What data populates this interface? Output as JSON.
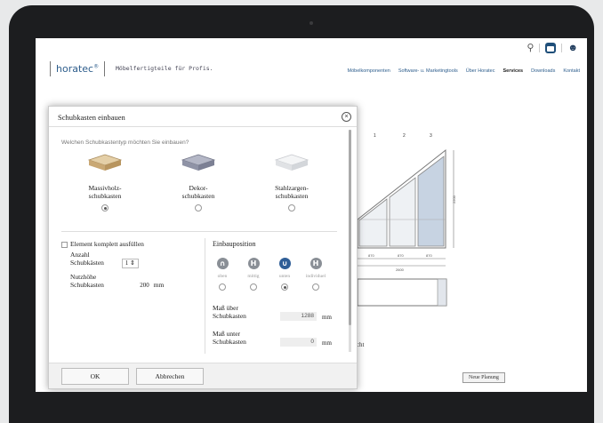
{
  "site": {
    "logo": "horatec",
    "logo_mark": "®",
    "tagline": "Möbelfertigteile für Profis.",
    "nav": [
      "Möbelkomponenten",
      "Software- u. Marketingtools",
      "Über Horatec",
      "Services",
      "Downloads",
      "Kontakt"
    ],
    "nav_active": "Services",
    "cart_count": "0"
  },
  "drawing": {
    "col_numbers": [
      "1",
      "2",
      "3"
    ],
    "dim_labels": [
      "870",
      "870",
      "870"
    ],
    "total_label": "2600",
    "height_label": "2200",
    "view_label": "icht",
    "new_plan_button": "Neue Planung"
  },
  "dialog": {
    "title": "Schubkasten einbauen",
    "question": "Welchen Schubkastentyp möchten Sie einbauen?",
    "types": [
      {
        "line1": "Massivholz-",
        "line2": "schubkasten",
        "selected": true,
        "color": "#d2b88a"
      },
      {
        "line1": "Dekor-",
        "line2": "schubkasten",
        "selected": false,
        "color": "#8f93a6"
      },
      {
        "line1": "Stahlzargen-",
        "line2": "schubkasten",
        "selected": false,
        "color": "#e6e7e9"
      }
    ],
    "fill_label": "Element komplett ausfüllen",
    "count_label1": "Anzahl",
    "count_label2": "Schubkästen",
    "count_value": "1",
    "height_label1": "Nutzhöhe",
    "height_label2": "Schubkasten",
    "height_value": "200",
    "height_unit": "mm",
    "position_title": "Einbauposition",
    "positions": [
      {
        "label": "oben",
        "selected": false
      },
      {
        "label": "mittig",
        "selected": false
      },
      {
        "label": "unten",
        "selected": true
      },
      {
        "label": "individuel",
        "selected": false
      }
    ],
    "above_label1": "Maß über",
    "above_label2": "Schubkasten",
    "above_value": "1288",
    "above_unit": "mm",
    "below_label1": "Maß unter",
    "below_label2": "Schubkasten",
    "below_value": "0",
    "below_unit": "mm",
    "ok_button": "OK",
    "cancel_button": "Abbrechen"
  }
}
